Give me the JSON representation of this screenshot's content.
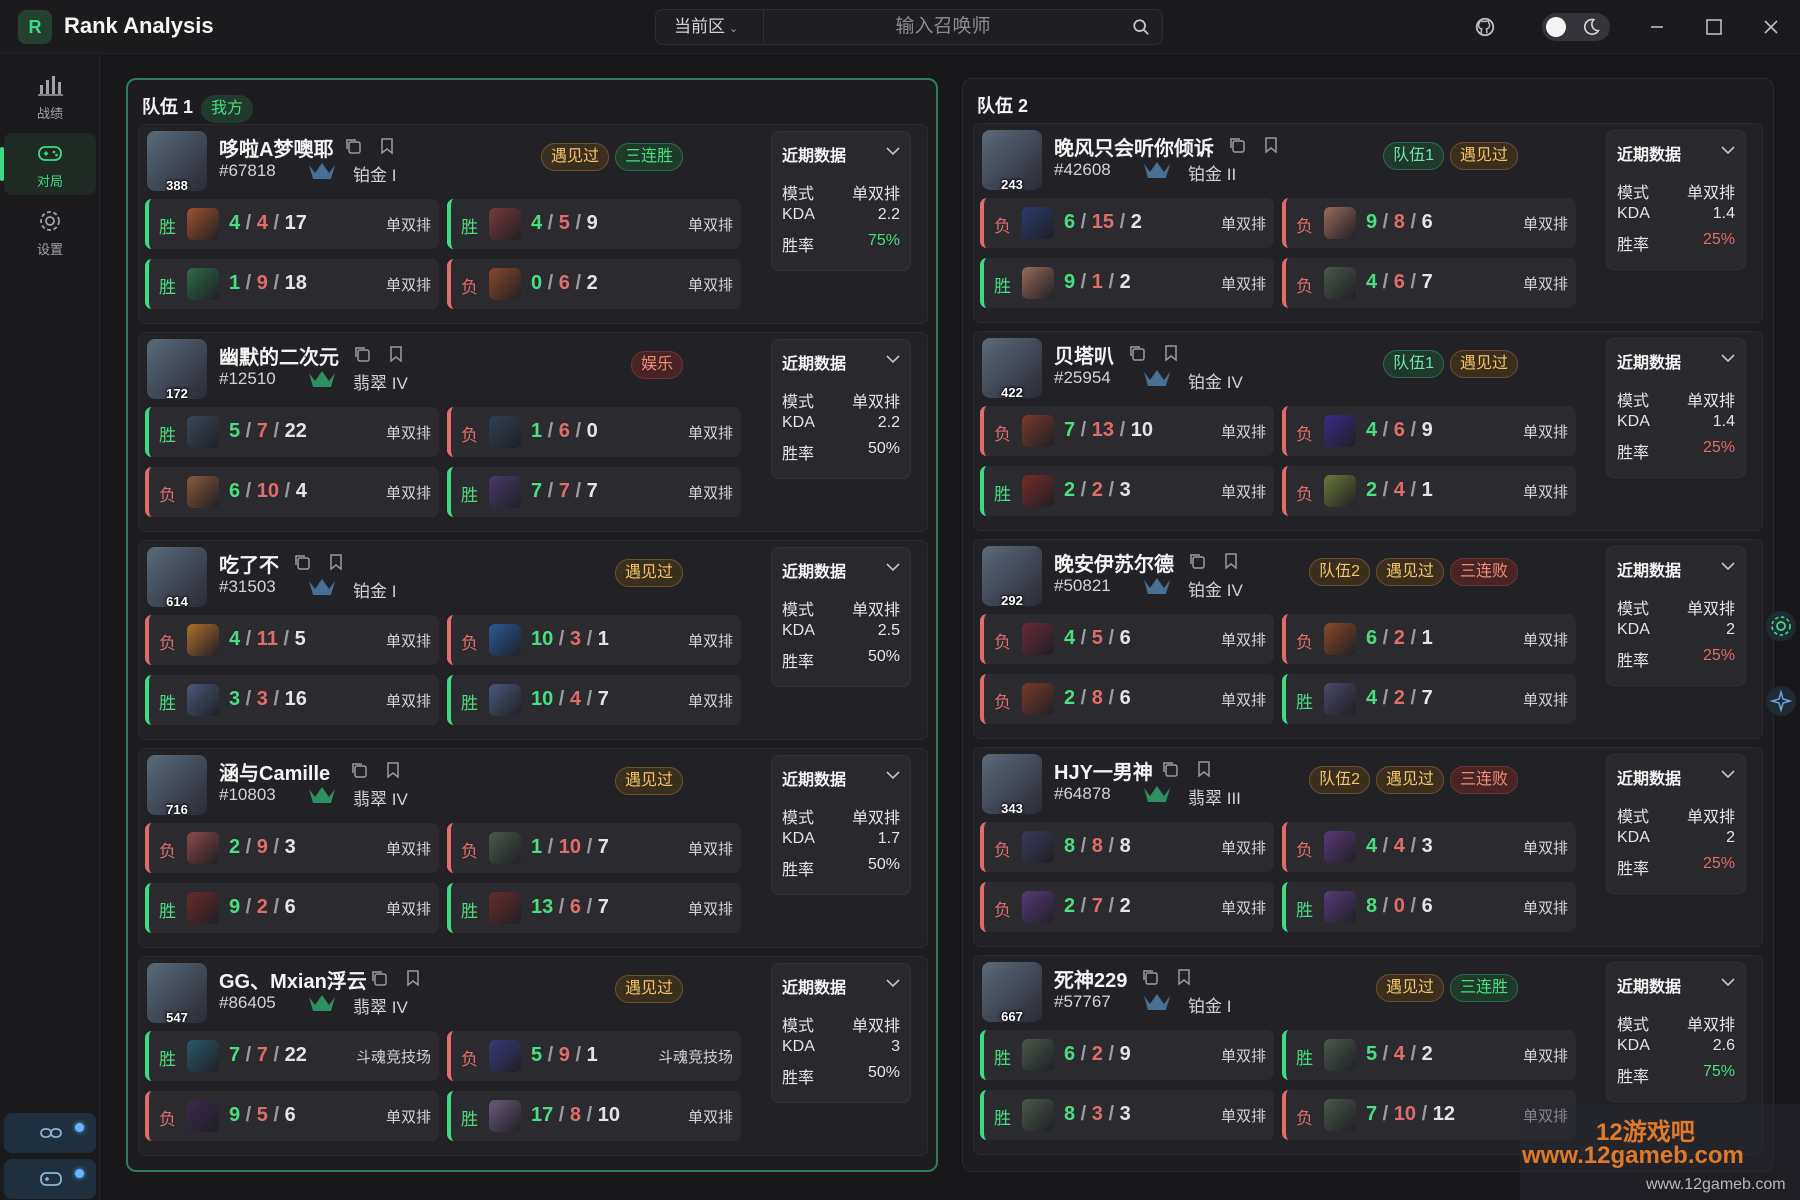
{
  "app": {
    "title": "Rank Analysis",
    "logo": "R"
  },
  "search": {
    "region": "当前区",
    "placeholder": "输入召唤师"
  },
  "sidebar": {
    "items": [
      {
        "label": "战绩",
        "icon": "bar-chart-icon"
      },
      {
        "label": "对局",
        "icon": "gamepad-icon"
      },
      {
        "label": "设置",
        "icon": "gear-icon"
      }
    ]
  },
  "stats_labels": {
    "title": "近期数据",
    "mode": "模式",
    "kda": "KDA",
    "winrate": "胜率"
  },
  "team1": {
    "title": "队伍 1",
    "tag": "我方",
    "players": [
      {
        "name": "哆啦A梦噢耶",
        "tag": "#67818",
        "level": "388",
        "rank": "铂金 I",
        "badges": [
          {
            "t": "遇见过",
            "c": "b-met"
          },
          {
            "t": "三连胜",
            "c": "b-win"
          }
        ],
        "stats": {
          "mode": "单双排",
          "kda": "2.2",
          "winrate": "75%",
          "wr_good": true
        },
        "matches": [
          {
            "res": "胜",
            "k": "4",
            "d": "4",
            "a": "17",
            "mode": "单双排",
            "color": "#a0522d"
          },
          {
            "res": "胜",
            "k": "4",
            "d": "5",
            "a": "9",
            "mode": "单双排",
            "color": "#7a3b3b"
          },
          {
            "res": "胜",
            "k": "1",
            "d": "9",
            "a": "18",
            "mode": "单双排",
            "color": "#2e6b48"
          },
          {
            "res": "负",
            "k": "0",
            "d": "6",
            "a": "2",
            "mode": "单双排",
            "color": "#8a4a2a"
          }
        ]
      },
      {
        "name": "幽默的二次元",
        "tag": "#12510",
        "level": "172",
        "rank": "翡翠 IV",
        "badges": [
          {
            "t": "娱乐",
            "c": "b-fun"
          }
        ],
        "stats": {
          "mode": "单双排",
          "kda": "2.2",
          "winrate": "50%",
          "wr_good": false
        },
        "matches": [
          {
            "res": "胜",
            "k": "5",
            "d": "7",
            "a": "22",
            "mode": "单双排",
            "color": "#3a4a5a"
          },
          {
            "res": "负",
            "k": "1",
            "d": "6",
            "a": "0",
            "mode": "单双排",
            "color": "#2f4052"
          },
          {
            "res": "负",
            "k": "6",
            "d": "10",
            "a": "4",
            "mode": "单双排",
            "color": "#8a5a3a"
          },
          {
            "res": "胜",
            "k": "7",
            "d": "7",
            "a": "7",
            "mode": "单双排",
            "color": "#4a3a6a"
          }
        ]
      },
      {
        "name": "吃了不",
        "tag": "#31503",
        "level": "614",
        "rank": "铂金 I",
        "badges": [
          {
            "t": "遇见过",
            "c": "b-met"
          }
        ],
        "stats": {
          "mode": "单双排",
          "kda": "2.5",
          "winrate": "50%",
          "wr_good": false
        },
        "matches": [
          {
            "res": "负",
            "k": "4",
            "d": "11",
            "a": "5",
            "mode": "单双排",
            "color": "#b0702a"
          },
          {
            "res": "负",
            "k": "10",
            "d": "3",
            "a": "1",
            "mode": "单双排",
            "color": "#2a5a9a"
          },
          {
            "res": "胜",
            "k": "3",
            "d": "3",
            "a": "16",
            "mode": "单双排",
            "color": "#4a5a7a"
          },
          {
            "res": "胜",
            "k": "10",
            "d": "4",
            "a": "7",
            "mode": "单双排",
            "color": "#4a5a7a"
          }
        ]
      },
      {
        "name": "涵与Camille",
        "tag": "#10803",
        "level": "716",
        "rank": "翡翠 IV",
        "badges": [
          {
            "t": "遇见过",
            "c": "b-met"
          }
        ],
        "stats": {
          "mode": "单双排",
          "kda": "1.7",
          "winrate": "50%",
          "wr_good": false
        },
        "matches": [
          {
            "res": "负",
            "k": "2",
            "d": "9",
            "a": "3",
            "mode": "单双排",
            "color": "#8a4a4a"
          },
          {
            "res": "负",
            "k": "1",
            "d": "10",
            "a": "7",
            "mode": "单双排",
            "color": "#4a5a4a"
          },
          {
            "res": "胜",
            "k": "9",
            "d": "2",
            "a": "6",
            "mode": "单双排",
            "color": "#6a2a2a"
          },
          {
            "res": "胜",
            "k": "13",
            "d": "6",
            "a": "7",
            "mode": "单双排",
            "color": "#6a2a2a"
          }
        ]
      },
      {
        "name": "GG、Mxian浮云",
        "tag": "#86405",
        "level": "547",
        "rank": "翡翠 IV",
        "badges": [
          {
            "t": "遇见过",
            "c": "b-met"
          }
        ],
        "stats": {
          "mode": "单双排",
          "kda": "3",
          "winrate": "50%",
          "wr_good": false
        },
        "matches": [
          {
            "res": "胜",
            "k": "7",
            "d": "7",
            "a": "22",
            "mode": "斗魂竞技场",
            "color": "#2a5a6a"
          },
          {
            "res": "负",
            "k": "5",
            "d": "9",
            "a": "1",
            "mode": "斗魂竞技场",
            "color": "#3a3a7a"
          },
          {
            "res": "负",
            "k": "9",
            "d": "5",
            "a": "6",
            "mode": "单双排",
            "color": "#3a2a4a"
          },
          {
            "res": "胜",
            "k": "17",
            "d": "8",
            "a": "10",
            "mode": "单双排",
            "color": "#6a5a7a"
          }
        ]
      }
    ]
  },
  "team2": {
    "title": "队伍 2",
    "players": [
      {
        "name": "晚风只会听你倾诉",
        "tag": "#42608",
        "level": "243",
        "rank": "铂金 II",
        "badges": [
          {
            "t": "队伍1",
            "c": "b-team"
          },
          {
            "t": "遇见过",
            "c": "b-met"
          }
        ],
        "stats": {
          "mode": "单双排",
          "kda": "1.4",
          "winrate": "25%",
          "wr_good": false
        },
        "matches": [
          {
            "res": "负",
            "k": "6",
            "d": "15",
            "a": "2",
            "mode": "单双排",
            "color": "#2a3a6a"
          },
          {
            "res": "负",
            "k": "9",
            "d": "8",
            "a": "6",
            "mode": "单双排",
            "color": "#9a6a5a"
          },
          {
            "res": "胜",
            "k": "9",
            "d": "1",
            "a": "2",
            "mode": "单双排",
            "color": "#9a6a5a"
          },
          {
            "res": "负",
            "k": "4",
            "d": "6",
            "a": "7",
            "mode": "单双排",
            "color": "#4a5a4a"
          }
        ]
      },
      {
        "name": "贝塔叭",
        "tag": "#25954",
        "level": "422",
        "rank": "铂金 IV",
        "badges": [
          {
            "t": "队伍1",
            "c": "b-team"
          },
          {
            "t": "遇见过",
            "c": "b-met"
          }
        ],
        "stats": {
          "mode": "单双排",
          "kda": "1.4",
          "winrate": "25%",
          "wr_good": false
        },
        "matches": [
          {
            "res": "负",
            "k": "7",
            "d": "13",
            "a": "10",
            "mode": "单双排",
            "color": "#7a3a2a"
          },
          {
            "res": "负",
            "k": "4",
            "d": "6",
            "a": "9",
            "mode": "单双排",
            "color": "#3a2a8a"
          },
          {
            "res": "胜",
            "k": "2",
            "d": "2",
            "a": "3",
            "mode": "单双排",
            "color": "#7a2a2a"
          },
          {
            "res": "负",
            "k": "2",
            "d": "4",
            "a": "1",
            "mode": "单双排",
            "color": "#6a7a3a"
          }
        ]
      },
      {
        "name": "晚安伊苏尔德",
        "tag": "#50821",
        "level": "292",
        "rank": "铂金 IV",
        "badges": [
          {
            "t": "队伍2",
            "c": "b-team2"
          },
          {
            "t": "遇见过",
            "c": "b-met"
          },
          {
            "t": "三连败",
            "c": "b-lose"
          }
        ],
        "stats": {
          "mode": "单双排",
          "kda": "2",
          "winrate": "25%",
          "wr_good": false
        },
        "matches": [
          {
            "res": "负",
            "k": "4",
            "d": "5",
            "a": "6",
            "mode": "单双排",
            "color": "#6a2a3a"
          },
          {
            "res": "负",
            "k": "6",
            "d": "2",
            "a": "1",
            "mode": "单双排",
            "color": "#8a4a2a"
          },
          {
            "res": "负",
            "k": "2",
            "d": "8",
            "a": "6",
            "mode": "单双排",
            "color": "#7a3a2a"
          },
          {
            "res": "胜",
            "k": "4",
            "d": "2",
            "a": "7",
            "mode": "单双排",
            "color": "#4a4a6a"
          }
        ]
      },
      {
        "name": "HJY一男神",
        "tag": "#64878",
        "level": "343",
        "rank": "翡翠 III",
        "badges": [
          {
            "t": "队伍2",
            "c": "b-team2"
          },
          {
            "t": "遇见过",
            "c": "b-met"
          },
          {
            "t": "三连败",
            "c": "b-lose"
          }
        ],
        "stats": {
          "mode": "单双排",
          "kda": "2",
          "winrate": "25%",
          "wr_good": false
        },
        "matches": [
          {
            "res": "负",
            "k": "8",
            "d": "8",
            "a": "8",
            "mode": "单双排",
            "color": "#3a3a5a"
          },
          {
            "res": "负",
            "k": "4",
            "d": "4",
            "a": "3",
            "mode": "单双排",
            "color": "#5a3a7a"
          },
          {
            "res": "负",
            "k": "2",
            "d": "7",
            "a": "2",
            "mode": "单双排",
            "color": "#5a3a7a"
          },
          {
            "res": "胜",
            "k": "8",
            "d": "0",
            "a": "6",
            "mode": "单双排",
            "color": "#5a3a7a"
          }
        ]
      },
      {
        "name": "死神229",
        "tag": "#57767",
        "level": "667",
        "rank": "铂金 I",
        "badges": [
          {
            "t": "遇见过",
            "c": "b-met"
          },
          {
            "t": "三连胜",
            "c": "b-win"
          }
        ],
        "stats": {
          "mode": "单双排",
          "kda": "2.6",
          "winrate": "75%",
          "wr_good": true
        },
        "matches": [
          {
            "res": "胜",
            "k": "6",
            "d": "2",
            "a": "9",
            "mode": "单双排",
            "color": "#4a5a4a"
          },
          {
            "res": "胜",
            "k": "5",
            "d": "4",
            "a": "2",
            "mode": "单双排",
            "color": "#4a5a4a"
          },
          {
            "res": "胜",
            "k": "8",
            "d": "3",
            "a": "3",
            "mode": "单双排",
            "color": "#4a5a4a"
          },
          {
            "res": "负",
            "k": "7",
            "d": "10",
            "a": "12",
            "mode": "单双排",
            "color": "#4a5a4a"
          }
        ]
      }
    ]
  },
  "watermark": {
    "line1": "12游戏吧",
    "line2": "www.12gameb.com"
  }
}
